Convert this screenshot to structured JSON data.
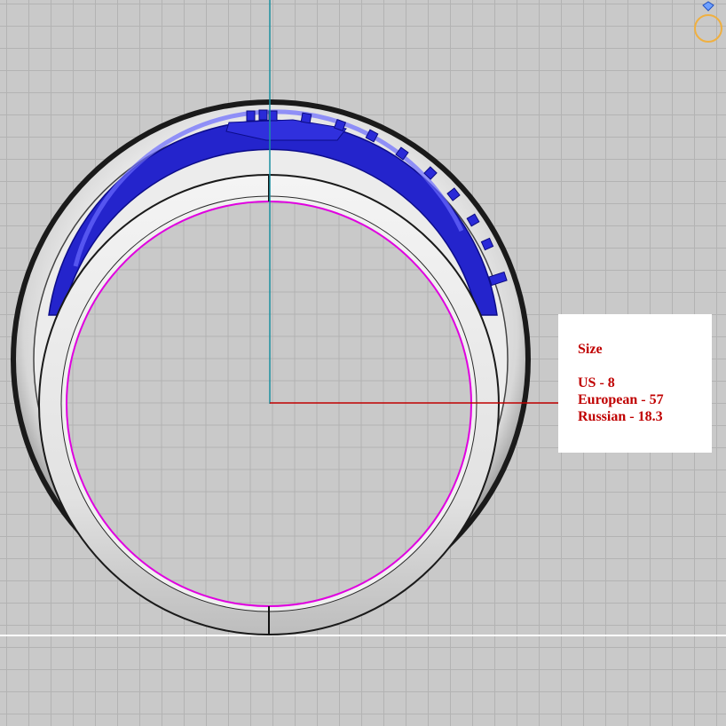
{
  "size_panel": {
    "title": "Size",
    "us": "US - 8",
    "european": "European - 57",
    "russian": "Russian - 18.3"
  },
  "colors": {
    "background": "#c9c9c9",
    "grid_line": "#b3b3b3",
    "vertical_axis": "#1a8fa0",
    "horizontal_axis": "#c00000",
    "inner_circle": "#e000e0",
    "stone_channel": "#2020d0",
    "ring_metal": "#e6e6e6",
    "label_text": "#c00000",
    "corner_widget": "#f0b040"
  },
  "icons": {
    "corner_widget": "view-gizmo-icon"
  }
}
